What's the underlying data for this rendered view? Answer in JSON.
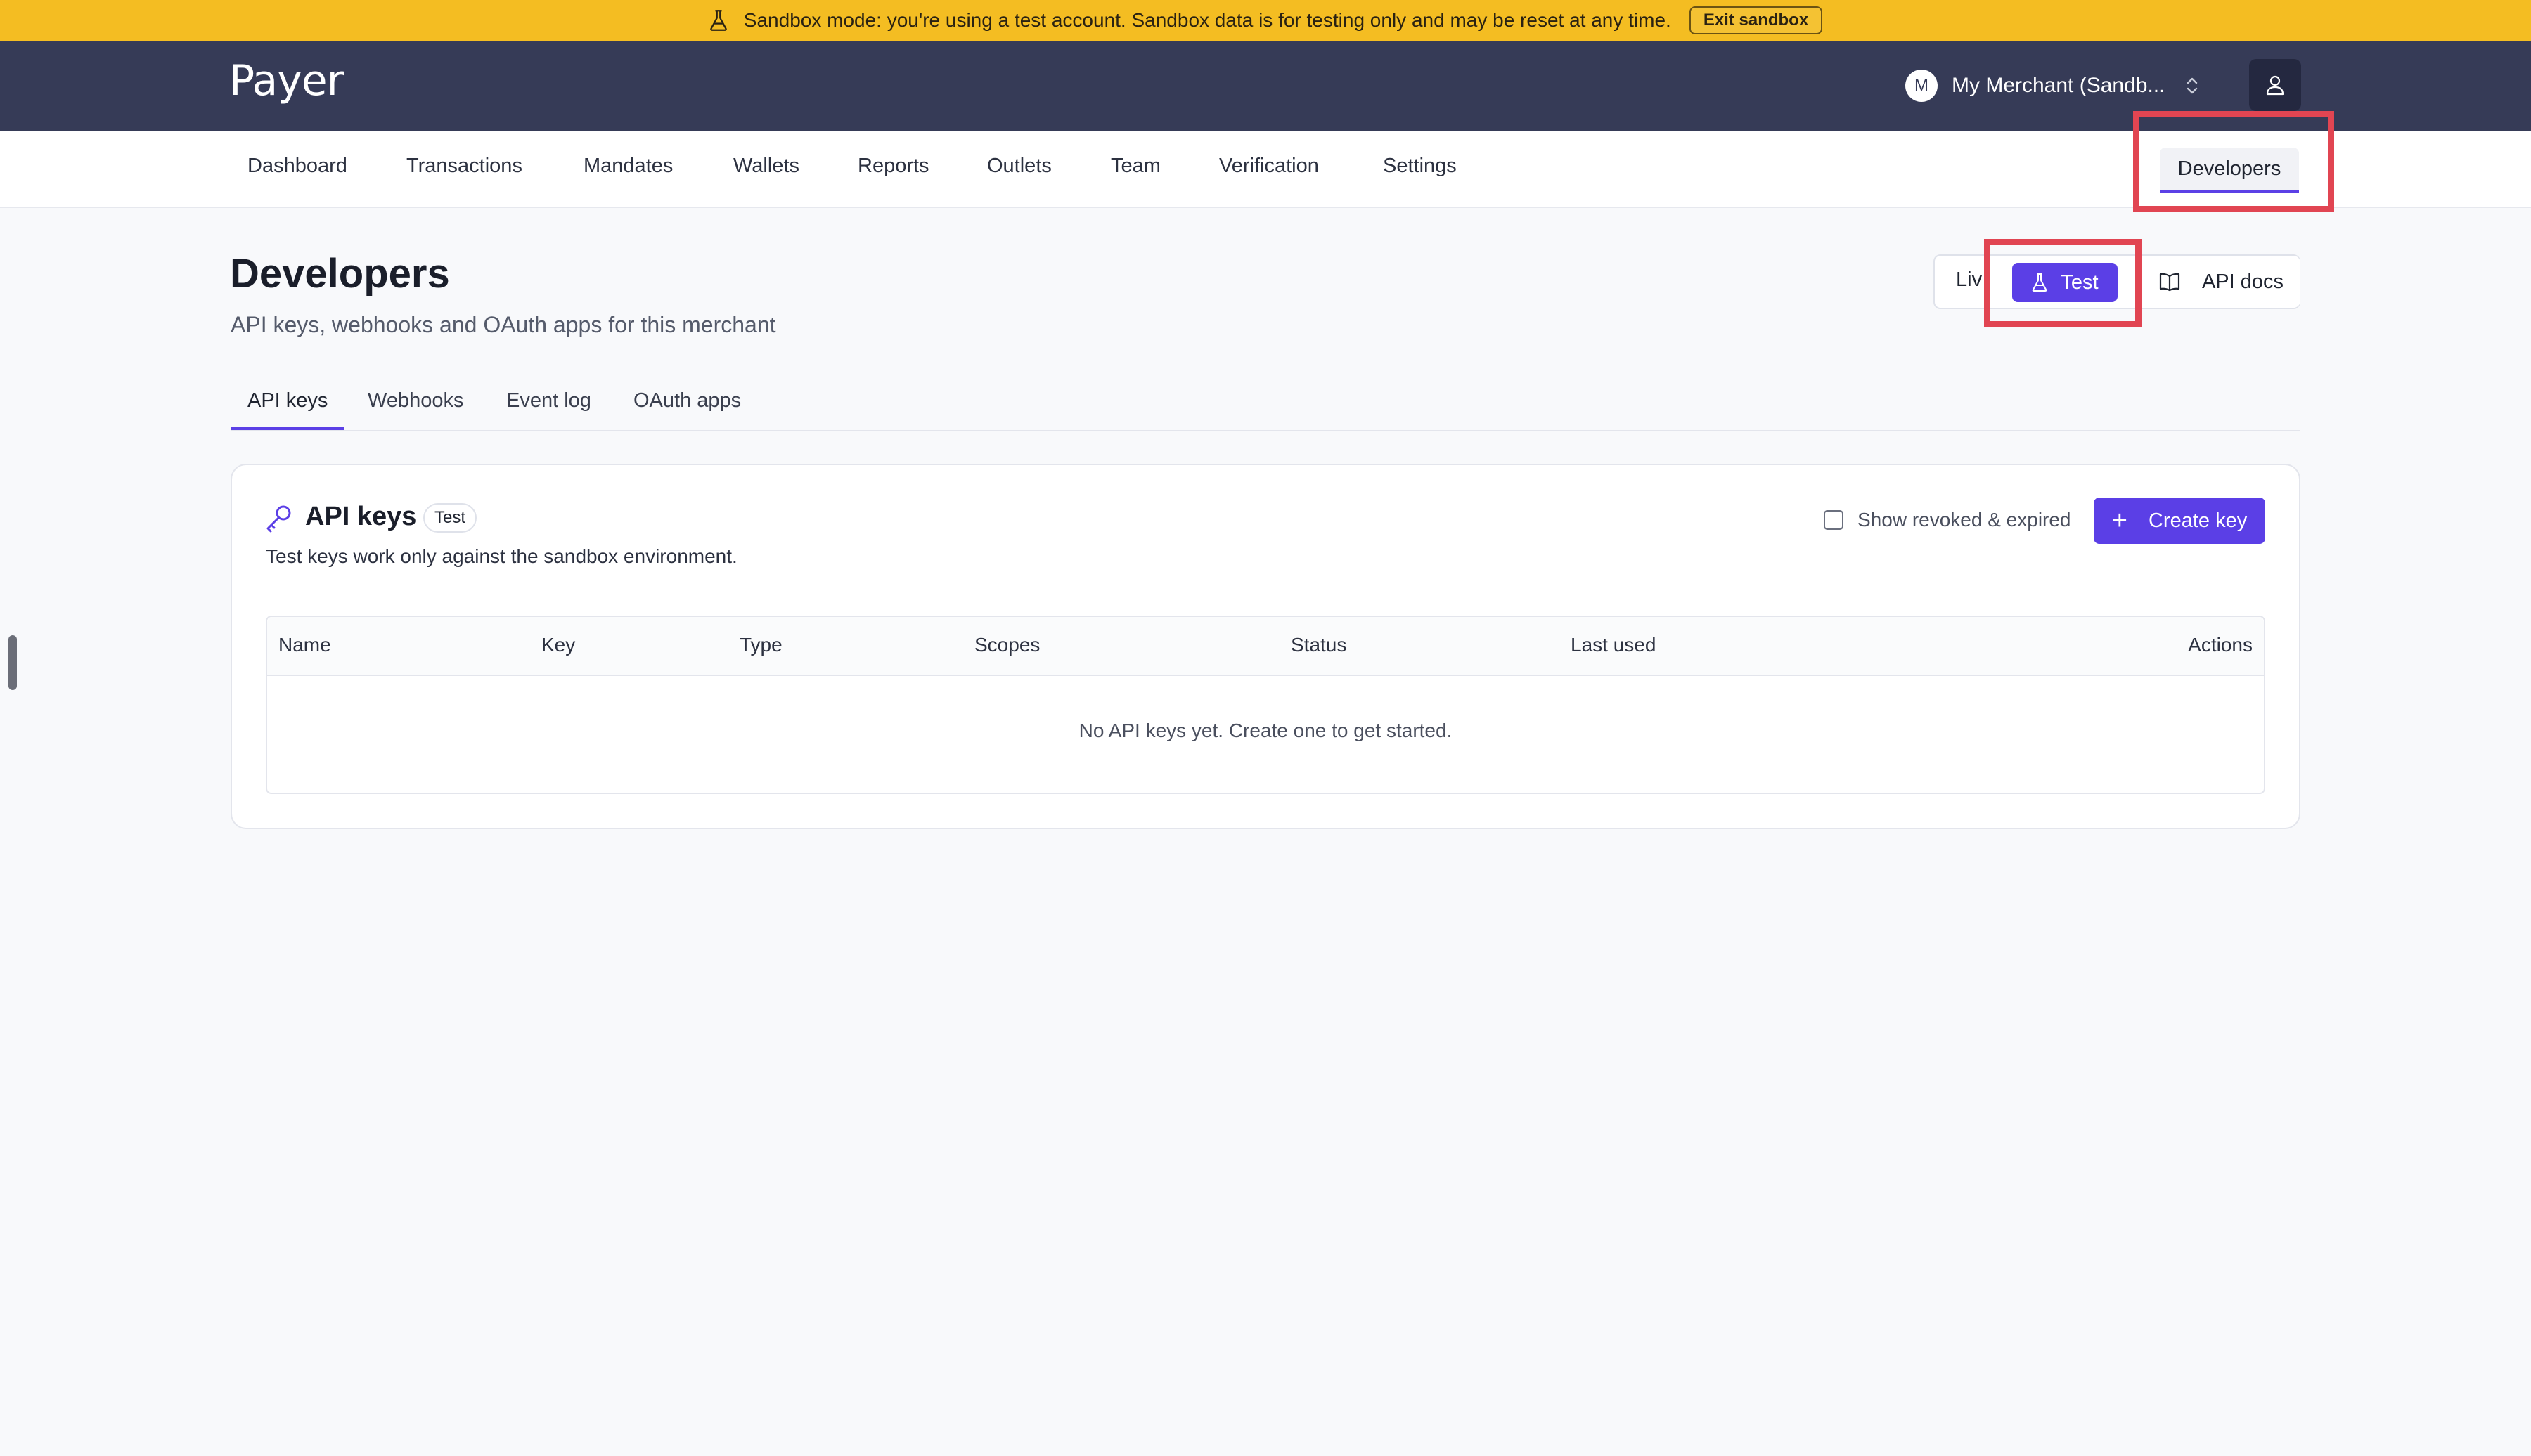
{
  "banner": {
    "text": "Sandbox mode: you're using a test account. Sandbox data is for testing only and may be reset at any time.",
    "exit_label": "Exit sandbox"
  },
  "header": {
    "logo": "Payer",
    "merchant_initial": "M",
    "merchant_name": "My Merchant (Sandb..."
  },
  "nav": {
    "items": [
      "Dashboard",
      "Transactions",
      "Mandates",
      "Wallets",
      "Reports",
      "Outlets",
      "Team",
      "Verification",
      "Settings"
    ],
    "active": "Developers"
  },
  "page": {
    "title": "Developers",
    "subtitle": "API keys, webhooks and OAuth apps for this merchant",
    "mode_live": "Liv",
    "mode_test": "Test",
    "api_docs": "API docs"
  },
  "tabs": [
    "API keys",
    "Webhooks",
    "Event log",
    "OAuth apps"
  ],
  "card": {
    "title": "API keys",
    "badge": "Test",
    "description": "Test keys work only against the sandbox environment.",
    "show_revoked_label": "Show revoked & expired",
    "create_label": "Create key",
    "columns": [
      "Name",
      "Key",
      "Type",
      "Scopes",
      "Status",
      "Last used",
      "Actions"
    ],
    "empty_text": "No API keys yet. Create one to get started."
  },
  "colors": {
    "banner": "#f4bd22",
    "header": "#363b57",
    "accent": "#5b3fe6",
    "highlight": "#e14552"
  }
}
